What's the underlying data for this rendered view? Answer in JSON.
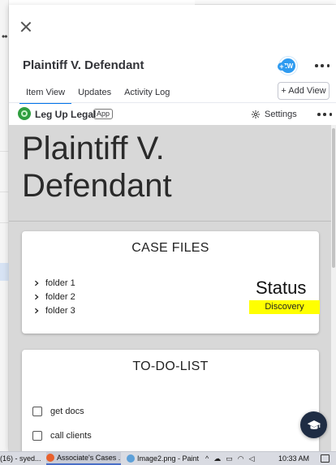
{
  "item": {
    "title": "Plaintiff V. Defendant",
    "avatar_initials": "ZW",
    "avatar_plus": "+"
  },
  "tabs": [
    {
      "label": "Item View",
      "active": true
    },
    {
      "label": "Updates",
      "active": false
    },
    {
      "label": "Activity Log",
      "active": false
    }
  ],
  "add_view_label": "+ Add View",
  "app": {
    "name": "Leg Up Legal",
    "badge": "App",
    "settings_label": "Settings"
  },
  "canvas": {
    "title_line1": "Plaintiff V.",
    "title_line2": "Defendant"
  },
  "case_files": {
    "heading": "CASE FILES",
    "folders": [
      "folder 1",
      "folder 2",
      "folder 3"
    ],
    "status_label": "Status",
    "status_value": "Discovery",
    "status_color": "#ffff00"
  },
  "todo": {
    "heading": "TO-DO-LIST",
    "items": [
      {
        "label": "get docs",
        "checked": false
      },
      {
        "label": "call clients",
        "checked": false
      }
    ]
  },
  "taskbar": {
    "items": [
      {
        "label": "(16) - syed...",
        "icon": "chrome-icon",
        "color": "#3b78e7"
      },
      {
        "label": "Associate's Cases ...",
        "icon": "firefox-icon",
        "color": "#e8602c"
      },
      {
        "label": "Image2.png - Paint",
        "icon": "paint-icon",
        "color": "#5da0d8"
      }
    ],
    "clock": "10:33 AM"
  },
  "colors": {
    "accent": "#0073ea",
    "brand_green": "#2f9e3f",
    "avatar_blue": "#2e9bf0",
    "help_fab": "#1f2d44",
    "canvas_bg": "#d8d8d8"
  }
}
